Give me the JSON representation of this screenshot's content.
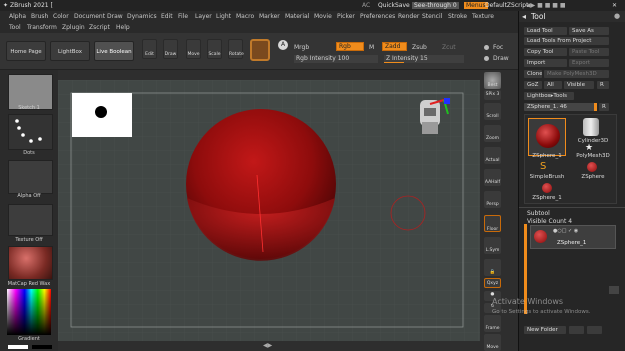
{
  "title_bar": {
    "app_title": "ZBrush 2021 [",
    "ac": "AC",
    "quicksave": "QuickSave",
    "see_through": "See-through  0",
    "menus": "Menus",
    "default_zscript": "DefaultZScript"
  },
  "menu_bar": {
    "items": [
      "Alpha",
      "Brush",
      "Color",
      "Document",
      "Draw",
      "Dynamics",
      "Edit",
      "File",
      "Layer",
      "Light",
      "Macro",
      "Marker",
      "Material",
      "Movie",
      "Picker",
      "Preferences",
      "Render",
      "Stencil",
      "Stroke",
      "Texture"
    ]
  },
  "sub_menu": {
    "items": [
      "Tool",
      "Transform",
      "Zplugin",
      "Zscript",
      "Help"
    ]
  },
  "toolbar": {
    "home_page": "Home Page",
    "lightbox": "LightBox",
    "live_boolean": "Live Boolean",
    "edit": "Edit",
    "draw": "Draw",
    "move": "Move",
    "scale": "Scale",
    "rotate": "Rotate",
    "a_label": "A",
    "mrgb": "Mrgb",
    "rgb": "Rgb",
    "m": "M",
    "zadd": "Zadd",
    "zsub": "Zsub",
    "zcut": "Zcut",
    "rgb_intensity": "Rgb Intensity 100",
    "z_intensity": "Z Intensity 15",
    "focal": "Foc",
    "draw_size": "Draw"
  },
  "left_panel": {
    "sketch": "Sketch 1",
    "dots": "Dots",
    "alpha_off": "Alpha Off",
    "texture_off": "Texture Off",
    "matcap": "MatCap Red Wax",
    "gradient": "Gradient"
  },
  "right_strip": {
    "items": [
      "Best",
      "SPix 3",
      "Scroll",
      "Zoom",
      "Actual",
      "AAHalf",
      "Persp",
      "Floor",
      "L.Sym",
      "",
      "Qxyz",
      "",
      "",
      "Frame",
      "Move"
    ]
  },
  "tool_panel": {
    "header": "Tool",
    "load_tool": "Load Tool",
    "save_as": "Save As",
    "load_from_project": "Load Tools From Project",
    "copy_tool": "Copy Tool",
    "paste_tool": "Paste Tool",
    "import": "Import",
    "export": "Export",
    "clone": "Clone",
    "make_polymesh": "Make PolyMesh3D",
    "goz": "GoZ",
    "all": "All",
    "visible": "Visible",
    "r": "R",
    "lightbox_tools": "Lightbox▸Tools",
    "zsphere_slider": "ZSphere_1. 46",
    "tools": [
      "ZSphere_1",
      "Cylinder3D",
      "PolyMesh3D",
      "SimpleBrush",
      "ZSphere",
      "ZSphere_1"
    ],
    "subtool": "Subtool",
    "visible_count": "Visible Count 4",
    "subtool_item": "ZSphere_1",
    "new_folder": "New Folder"
  },
  "watermark": {
    "line1": "Activate Windows",
    "line2": "Go to Settings to activate Windows."
  },
  "colors": {
    "accent": "#f08c1c",
    "sphere": "#b01010"
  }
}
